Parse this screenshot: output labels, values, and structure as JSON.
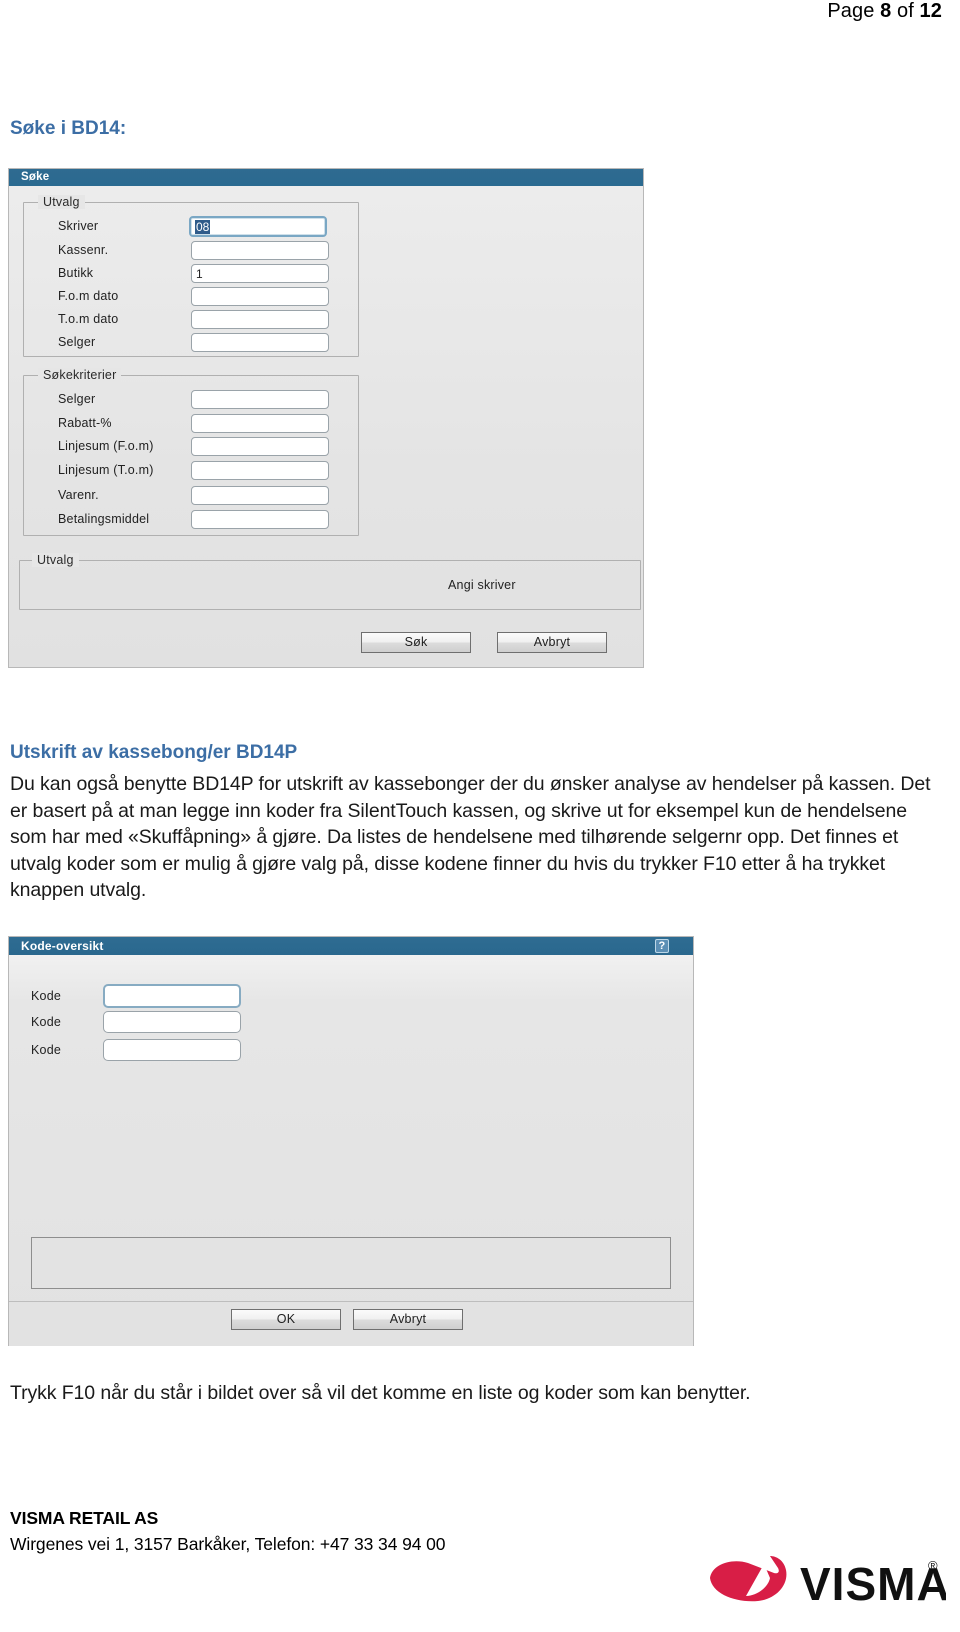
{
  "page": {
    "header_prefix": "Page ",
    "header_number": "8",
    "header_mid": " of ",
    "header_total": "12"
  },
  "headings": {
    "soke": "Søke i BD14:",
    "utskrift": "Utskrift av kassebong/er BD14P"
  },
  "paragraphs": {
    "main": "Du kan også benytte BD14P for utskrift av kassebonger der du ønsker analyse av hendelser på kassen.  Det er basert på at man legge inn koder fra SilentTouch kassen, og skrive ut for eksempel kun de hendelsene som har med «Skuffåpning» å gjøre. Da listes de hendelsene med tilhørende selgernr opp. Det finnes et utvalg koder som er mulig å gjøre valg på, disse kodene finner du hvis du trykker F10 etter å ha trykket knappen utvalg.",
    "bottom": "Trykk F10 når du står i bildet over så vil det komme en liste og koder som kan benytter."
  },
  "soke_dialog": {
    "title": "Søke",
    "group_utvalg": {
      "legend": "Utvalg",
      "fields": [
        {
          "label": "Skriver",
          "value": "08",
          "focused": true,
          "selected": true
        },
        {
          "label": "Kassenr.",
          "value": "",
          "focused": false,
          "selected": false
        },
        {
          "label": "Butikk",
          "value": "1",
          "focused": false,
          "selected": false
        },
        {
          "label": "F.o.m dato",
          "value": "",
          "focused": false,
          "selected": false
        },
        {
          "label": "T.o.m dato",
          "value": "",
          "focused": false,
          "selected": false
        },
        {
          "label": "Selger",
          "value": "",
          "focused": false,
          "selected": false
        }
      ]
    },
    "group_sokekriterier": {
      "legend": "Søkekriterier",
      "fields": [
        {
          "label": "Selger",
          "value": ""
        },
        {
          "label": "Rabatt-%",
          "value": ""
        },
        {
          "label": "Linjesum (F.o.m)",
          "value": ""
        },
        {
          "label": "Linjesum (T.o.m)",
          "value": ""
        },
        {
          "label": "Varenr.",
          "value": ""
        },
        {
          "label": "Betalingsmiddel",
          "value": ""
        }
      ]
    },
    "group_bottom": {
      "legend": "Utvalg",
      "text": "Angi skriver"
    },
    "buttons": {
      "ok": "Søk",
      "cancel": "Avbryt"
    }
  },
  "kode_dialog": {
    "title": "Kode-oversikt",
    "help_glyph": "?",
    "fields": [
      {
        "label": "Kode",
        "value": "",
        "focused": true
      },
      {
        "label": "Kode",
        "value": "",
        "focused": false
      },
      {
        "label": "Kode",
        "value": "",
        "focused": false
      }
    ],
    "buttons": {
      "ok": "OK",
      "cancel": "Avbryt"
    }
  },
  "footer": {
    "company": "VISMA RETAIL AS",
    "address": "Wirgenes vei 1, 3157 Barkåker, Telefon: +47 33 34 94 00",
    "logo_text": "VISMA",
    "logo_mark": "®"
  },
  "colors": {
    "heading_blue": "#3c6ea5",
    "titlebar_teal": "#2d6a90",
    "logo_red": "#d81e46",
    "dialog_gray": "#e3e3e3"
  }
}
